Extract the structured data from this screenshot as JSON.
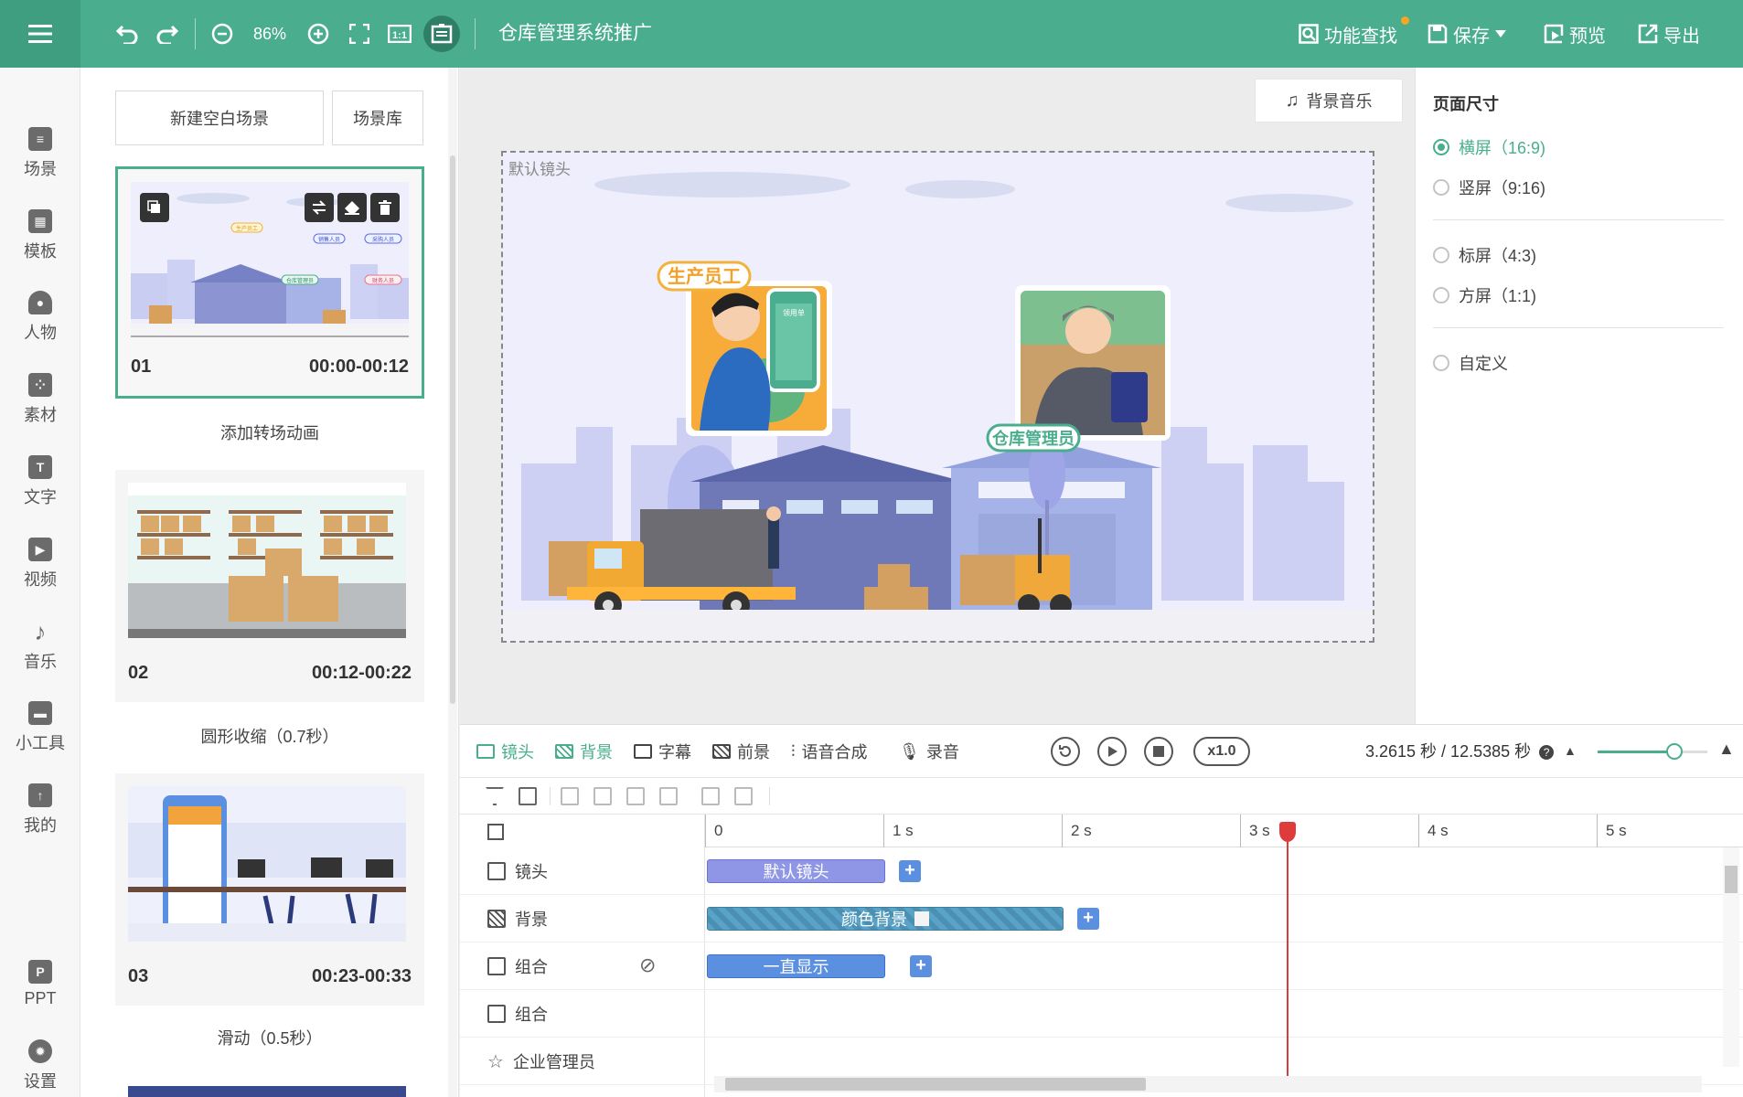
{
  "topbar": {
    "zoom": "86%",
    "project_title": "仓库管理系统推广",
    "feature_search": "功能查找",
    "save": "保存",
    "preview": "预览",
    "export": "导出"
  },
  "rail": {
    "items": [
      {
        "label": "场景",
        "icon": "scene-icon"
      },
      {
        "label": "模板",
        "icon": "template-icon"
      },
      {
        "label": "人物",
        "icon": "person-icon"
      },
      {
        "label": "素材",
        "icon": "asset-icon"
      },
      {
        "label": "文字",
        "icon": "text-icon"
      },
      {
        "label": "视频",
        "icon": "video-icon"
      },
      {
        "label": "音乐",
        "icon": "music-icon"
      },
      {
        "label": "小工具",
        "icon": "toolbox-icon"
      },
      {
        "label": "我的",
        "icon": "upload-icon"
      },
      {
        "label": "PPT",
        "icon": "ppt-icon"
      },
      {
        "label": "设置",
        "icon": "gear-icon"
      }
    ]
  },
  "scenes": {
    "new_blank": "新建空白场景",
    "library": "场景库",
    "items": [
      {
        "num": "01",
        "time": "00:00-00:12",
        "transition": "添加转场动画"
      },
      {
        "num": "02",
        "time": "00:12-00:22",
        "transition": "圆形收缩（0.7秒）"
      },
      {
        "num": "03",
        "time": "00:23-00:33",
        "transition": "滑动（0.5秒）"
      }
    ],
    "thumb1": {
      "tag1": "生产员工",
      "tag2": "销售人员",
      "tag3": "采购人员",
      "tag4": "仓库管理员",
      "tag5": "财务人员"
    }
  },
  "canvas": {
    "bgm": "背景音乐",
    "stage_label": "默认镜头",
    "tag_producer": "生产员工",
    "tag_warehouse": "仓库管理员",
    "phone_title": "领用单"
  },
  "props": {
    "title": "页面尺寸",
    "options": [
      {
        "label": "横屏（16:9)",
        "selected": true
      },
      {
        "label": "竖屏（9:16)",
        "selected": false
      },
      {
        "label": "标屏（4:3)",
        "selected": false
      },
      {
        "label": "方屏（1:1)",
        "selected": false
      },
      {
        "label": "自定义",
        "selected": false
      }
    ]
  },
  "timeline": {
    "tabs": [
      "镜头",
      "背景",
      "字幕",
      "前景",
      "语音合成",
      "录音"
    ],
    "speed": "x1.0",
    "time_readout": "3.2615 秒 / 12.5385 秒",
    "zoom_level": 0.7,
    "ruler": [
      "0",
      "1 s",
      "2 s",
      "3 s",
      "4 s",
      "5 s"
    ],
    "tracks": [
      {
        "label": "镜头"
      },
      {
        "label": "背景"
      },
      {
        "label": "组合"
      },
      {
        "label": "组合"
      },
      {
        "label": "企业管理员"
      }
    ],
    "clips": {
      "camera": "默认镜头",
      "background": "颜色背景",
      "group": "一直显示"
    },
    "playhead_seconds": 3.2615
  },
  "colors": {
    "brand": "#4aae8e",
    "clip_camera": "#8f96e6",
    "clip_bg": "#5aa3c8",
    "clip_group": "#5b8fe0",
    "playhead": "#e03b3b"
  }
}
